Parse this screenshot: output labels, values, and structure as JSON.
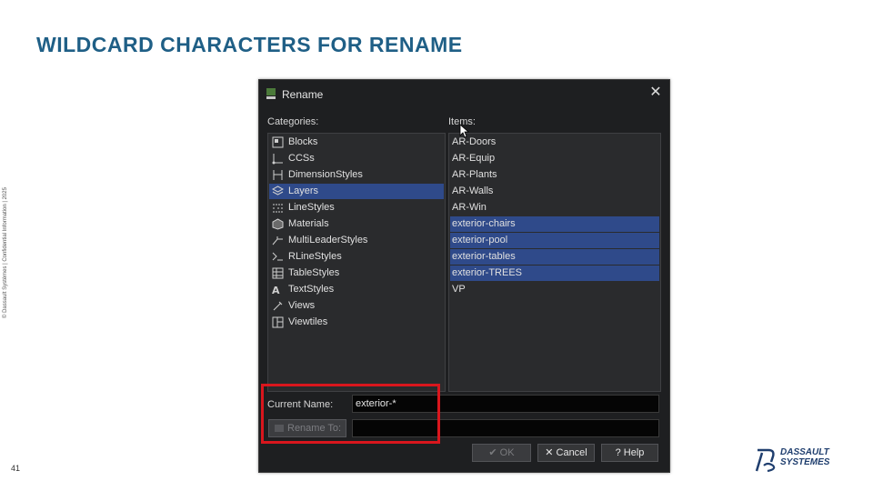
{
  "slide": {
    "title": "WILDCARD CHARACTERS FOR RENAME",
    "side_note": "© Dassault Systèmes | Confidential Information | 2025",
    "page_number": "41",
    "logo_line1": "DASSAULT",
    "logo_line2": "SYSTEMES"
  },
  "dialog": {
    "title": "Rename",
    "categories_label": "Categories:",
    "items_label": "Items:",
    "categories": [
      {
        "label": "Blocks",
        "icon": "blocks-icon",
        "selected": false
      },
      {
        "label": "CCSs",
        "icon": "ccs-icon",
        "selected": false
      },
      {
        "label": "DimensionStyles",
        "icon": "dimension-styles-icon",
        "selected": false
      },
      {
        "label": "Layers",
        "icon": "layers-icon",
        "selected": true
      },
      {
        "label": "LineStyles",
        "icon": "line-styles-icon",
        "selected": false
      },
      {
        "label": "Materials",
        "icon": "materials-icon",
        "selected": false
      },
      {
        "label": "MultiLeaderStyles",
        "icon": "multileader-styles-icon",
        "selected": false
      },
      {
        "label": "RLineStyles",
        "icon": "rline-styles-icon",
        "selected": false
      },
      {
        "label": "TableStyles",
        "icon": "table-styles-icon",
        "selected": false
      },
      {
        "label": "TextStyles",
        "icon": "text-styles-icon",
        "selected": false
      },
      {
        "label": "Views",
        "icon": "views-icon",
        "selected": false
      },
      {
        "label": "Viewtiles",
        "icon": "viewtiles-icon",
        "selected": false
      }
    ],
    "items": [
      {
        "label": "AR-Doors",
        "selected": false
      },
      {
        "label": "AR-Equip",
        "selected": false
      },
      {
        "label": "AR-Plants",
        "selected": false
      },
      {
        "label": "AR-Walls",
        "selected": false
      },
      {
        "label": "AR-Win",
        "selected": false
      },
      {
        "label": "exterior-chairs",
        "selected": true
      },
      {
        "label": "exterior-pool",
        "selected": true
      },
      {
        "label": "exterior-tables",
        "selected": true
      },
      {
        "label": "exterior-TREES",
        "selected": true
      },
      {
        "label": "VP",
        "selected": false
      }
    ],
    "current_name_label": "Current Name:",
    "current_name_value": "exterior-*",
    "rename_to_label": "Rename To:",
    "rename_to_value": "",
    "ok_label": "✔ OK",
    "cancel_label": "✕ Cancel",
    "help_label": "? Help"
  }
}
